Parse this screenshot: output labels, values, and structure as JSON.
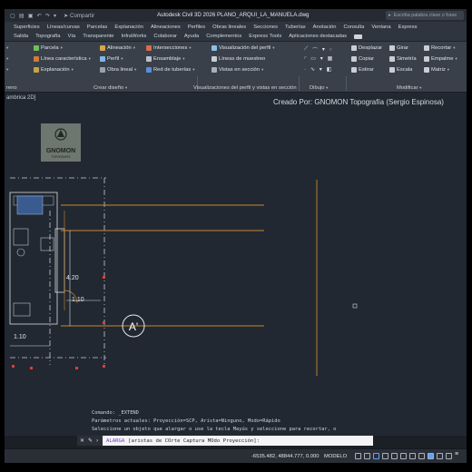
{
  "titlebar": {
    "share_label": "Compartir",
    "app_title": "Autodesk Civil 3D 2026   PLANO_ARQUI_LA_MANUELA.dwg",
    "search_placeholder": "Escriba palabra clave o frase"
  },
  "tabs_row1": [
    "Superficies",
    "Líneas/curvas",
    "Parcelas",
    "Explanación",
    "Alineaciones",
    "Perfiles",
    "Obras lineales",
    "Secciones",
    "Tuberías",
    "Anotación",
    "Consulta",
    "Ventana",
    "Express"
  ],
  "tabs_row2": [
    "Salida",
    "Topografía",
    "Vía",
    "Transparente",
    "InfraWorks",
    "Colaborar",
    "Ayuda",
    "Complementos",
    "Express Tools",
    "Aplicaciones destacadas"
  ],
  "ribbon": {
    "parcela": "Parcela",
    "linea_caracteristica": "Línea característica",
    "explanacion": "Explanación",
    "alineacion": "Alineación",
    "perfil": "Perfil",
    "obra_lineal": "Obra lineal",
    "intersecciones": "Intersecciones",
    "ensamblaje": "Ensamblaje",
    "red_tuberias": "Red de tuberías",
    "visualizacion_perfil": "Visualización del perfil",
    "lineas_muestreo": "Líneas de muestreo",
    "vistas_seccion": "Vistas en sección",
    "desplazar": "Desplazar",
    "copiar": "Copiar",
    "estirar": "Estirar",
    "girar": "Girar",
    "simetria": "Simetría",
    "escala": "Escala",
    "recortar": "Recortar",
    "empalme": "Empalme",
    "matriz": "Matriz",
    "group_reno": "reno",
    "group_crear_diseno": "Crear diseño",
    "group_visualizaciones": "Visualizaciones del perfil y vistas en sección",
    "group_dibujo": "Dibujo",
    "group_modificar": "Modificar"
  },
  "canvas": {
    "view_tag": "ambrica 2D]",
    "credit": "Creado Por: GNOMON Topografía (Sergio Espinosa)",
    "logo_text": "GNOMON",
    "logo_sub": "TOPOGRAFÍA",
    "dim_420": "4.20",
    "dim_110_a": "1.10",
    "dim_110_b": "1.10",
    "section_label": "A'"
  },
  "command": {
    "history": [
      "Comando: _EXTEND",
      "Parámetros actuales: Proyección=SCP, Arista=Ninguno, Modo=Rápido",
      "Seleccione un objeto que alargar o use la tecla Mayús y seleccione para recortar, o"
    ],
    "prompt_name": "ALARGA",
    "prompt_text": "[aristas de COrte Captura MOdo Proyección]:"
  },
  "status": {
    "coords": "-6535.482, 48844.777, 0.000",
    "model": "MODELO"
  },
  "colors": {
    "accent": "#5ba3ff",
    "drawing_bg": "#212831",
    "orange_line": "#c9892e",
    "red_marker": "#e23b3b"
  }
}
